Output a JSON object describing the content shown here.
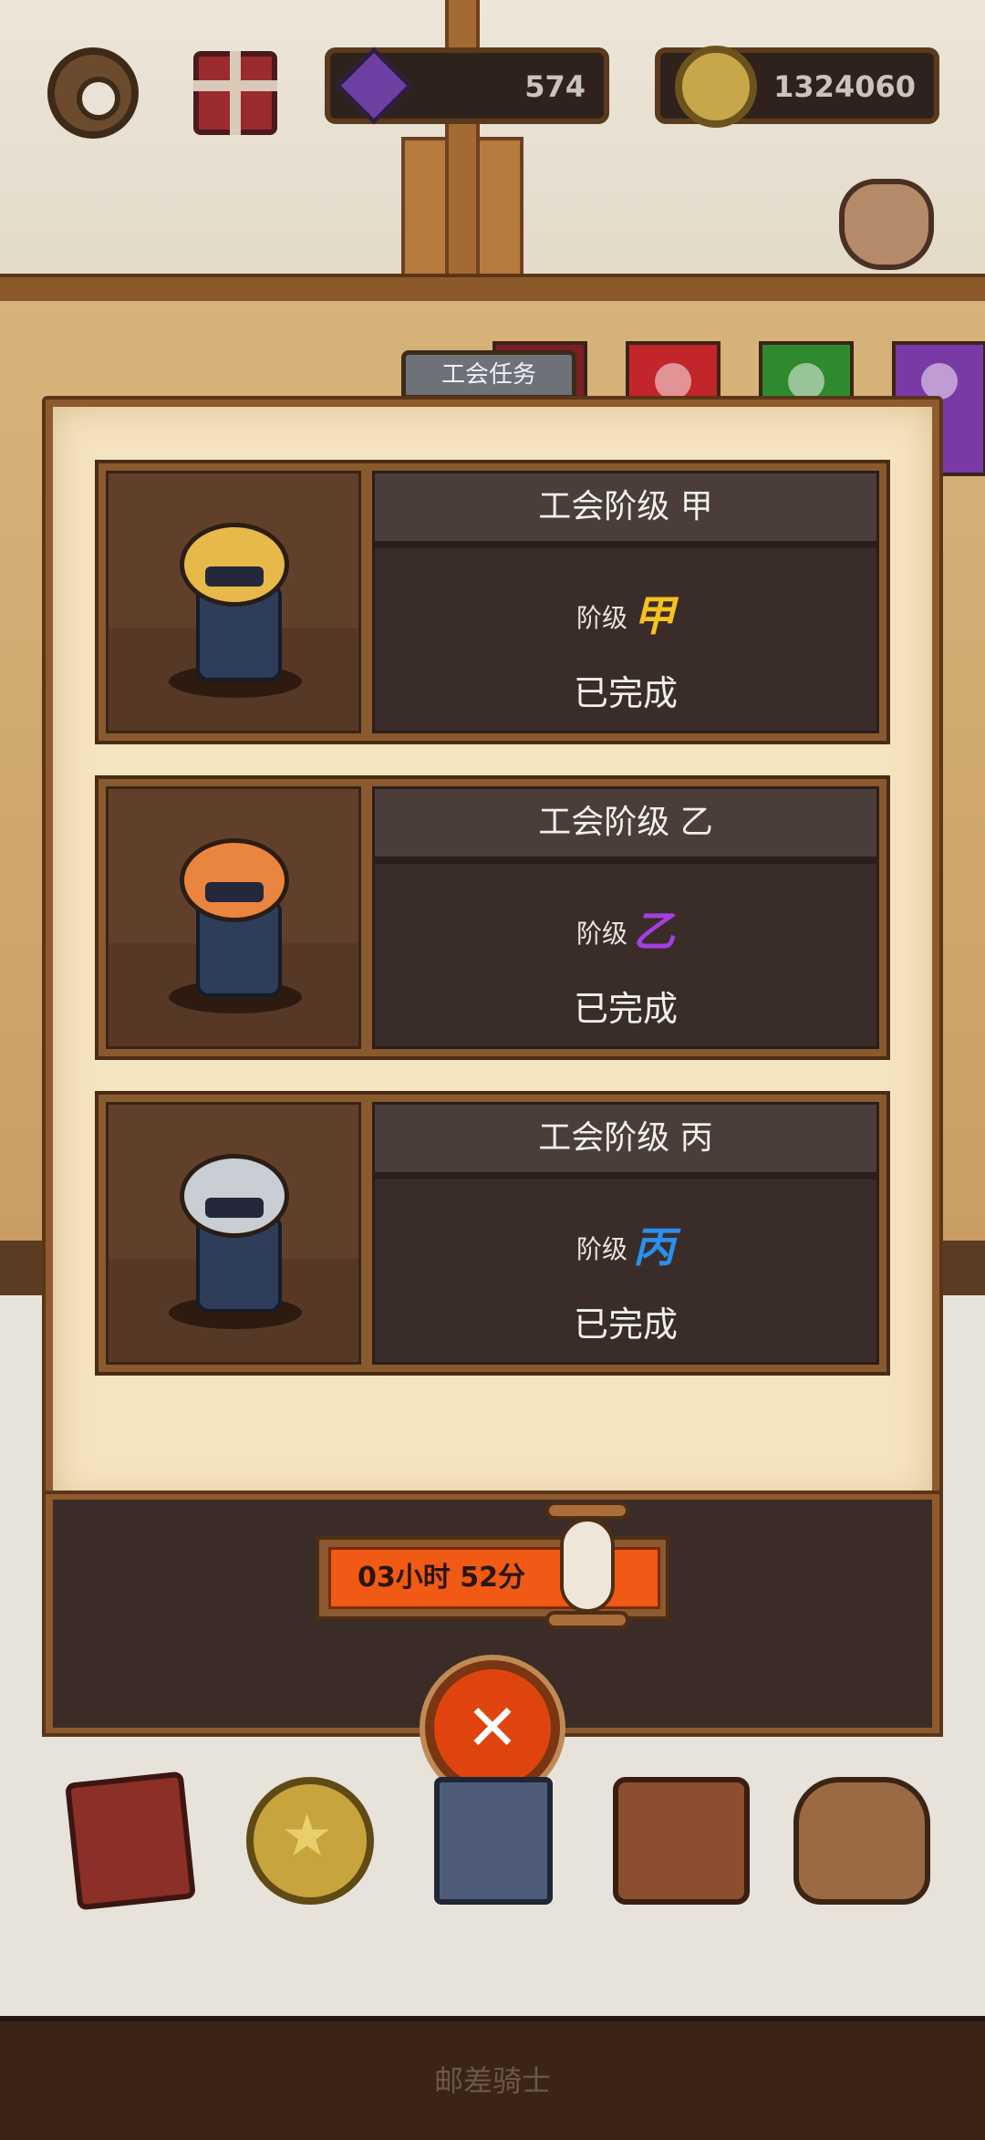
{
  "hud": {
    "gems": "574",
    "coins": "1324060"
  },
  "tab_label": "工会任务",
  "ranks": [
    {
      "title": "工会阶级 甲",
      "grade_label": "阶级",
      "grade": "甲",
      "grade_color": "#f6c21e",
      "status": "已完成",
      "helmet_color": "#e6b94a"
    },
    {
      "title": "工会阶级 乙",
      "grade_label": "阶级",
      "grade": "乙",
      "grade_color": "#a43fe0",
      "status": "已完成",
      "helmet_color": "#e9853f"
    },
    {
      "title": "工会阶级 丙",
      "grade_label": "阶级",
      "grade": "丙",
      "grade_color": "#2a8ff0",
      "status": "已完成",
      "helmet_color": "#c9cdd4"
    }
  ],
  "timer": "03小时 52分",
  "close_label": "✕",
  "bottom_title": "邮差骑士",
  "icons": {
    "settings": "gear-icon",
    "gift": "gift-icon",
    "gem": "gem-icon",
    "coin": "coin-icon",
    "loot_sack": "sack-icon",
    "hourglass": "hourglass-icon"
  }
}
